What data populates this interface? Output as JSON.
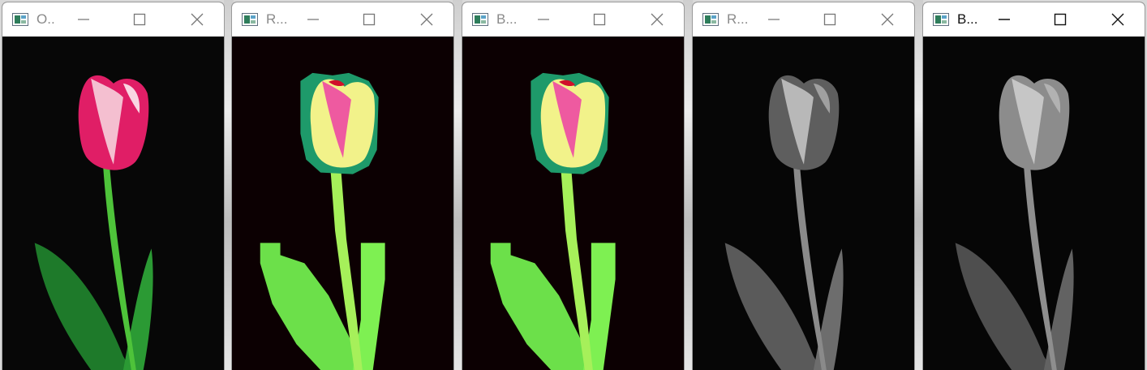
{
  "windows": [
    {
      "title": "O..",
      "view": "original"
    },
    {
      "title": "R...",
      "view": "false-color"
    },
    {
      "title": "B...",
      "view": "false-color"
    },
    {
      "title": "R...",
      "view": "grayscale"
    },
    {
      "title": "B...",
      "view": "grayscale"
    }
  ],
  "controls": {
    "minimize_icon": "minimize-icon",
    "maximize_icon": "maximize-icon",
    "close_icon": "close-icon"
  },
  "colors": {
    "petal": "#e8236e",
    "stem": "#3cab2b",
    "leaf": "#1f8a2c",
    "false_petal": "#f2f28a",
    "false_leaf": "#7cf04a",
    "gray_petal": "#9a9a9a",
    "gray_leaf": "#6a6a6a"
  }
}
